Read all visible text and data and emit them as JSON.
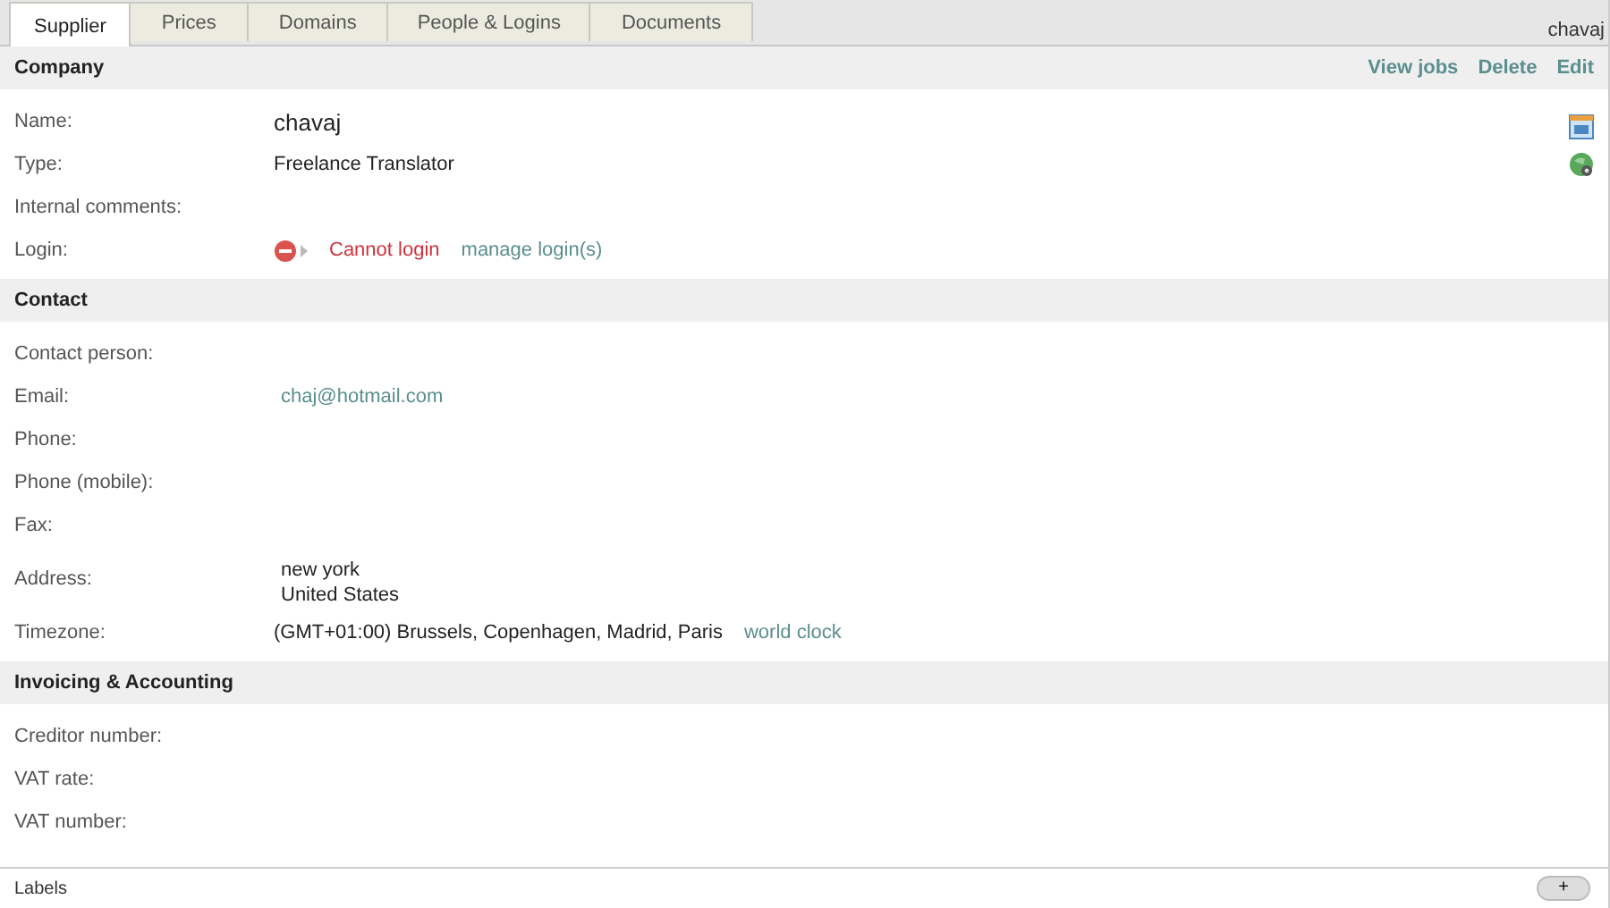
{
  "tabs": [
    {
      "label": "Supplier",
      "selected": true
    },
    {
      "label": "Prices",
      "selected": false
    },
    {
      "label": "Domains",
      "selected": false
    },
    {
      "label": "People & Logins",
      "selected": false
    },
    {
      "label": "Documents",
      "selected": false
    }
  ],
  "user": "chavaj",
  "sections": [
    {
      "title": "Company",
      "actions": [
        "View jobs",
        "Delete",
        "Edit"
      ],
      "side_icons": [
        {
          "kind": "calendar"
        },
        {
          "kind": "globe"
        }
      ],
      "fields": [
        {
          "label": "Name:",
          "value": [
            {
              "kind": "large",
              "text": "chavaj"
            }
          ]
        },
        {
          "label": "Type:",
          "value": [
            {
              "kind": "text",
              "text": "Freelance Translator"
            }
          ]
        },
        {
          "label": "Internal comments:"
        },
        {
          "label": "Login:",
          "value": [
            {
              "kind": "status",
              "text": "Cannot login"
            },
            {
              "kind": "link",
              "text": "manage login(s)"
            }
          ]
        }
      ]
    },
    {
      "title": "Contact",
      "fields": [
        {
          "label": "Contact person:"
        },
        {
          "label": "Email:",
          "value": [
            {
              "kind": "link",
              "text": "chaj@hotmail.com"
            }
          ]
        },
        {
          "label": "Phone:"
        },
        {
          "label": "Phone (mobile):"
        },
        {
          "label": "Fax:"
        },
        {
          "label": "Address:",
          "value": [
            {
              "kind": "lines",
              "lines": [
                "new york",
                "United States"
              ]
            }
          ]
        },
        {
          "label": "Timezone:",
          "value": [
            {
              "kind": "text",
              "text": "(GMT+01:00) Brussels, Copenhagen, Madrid, Paris"
            },
            {
              "kind": "link",
              "text": "world clock"
            }
          ]
        }
      ]
    },
    {
      "title": "Invoicing & Accounting",
      "fields": [
        {
          "label": "Creditor number:"
        },
        {
          "label": "VAT rate:"
        },
        {
          "label": "VAT number:"
        }
      ]
    }
  ],
  "labels_bar": {
    "title": "Labels",
    "button": "+"
  }
}
